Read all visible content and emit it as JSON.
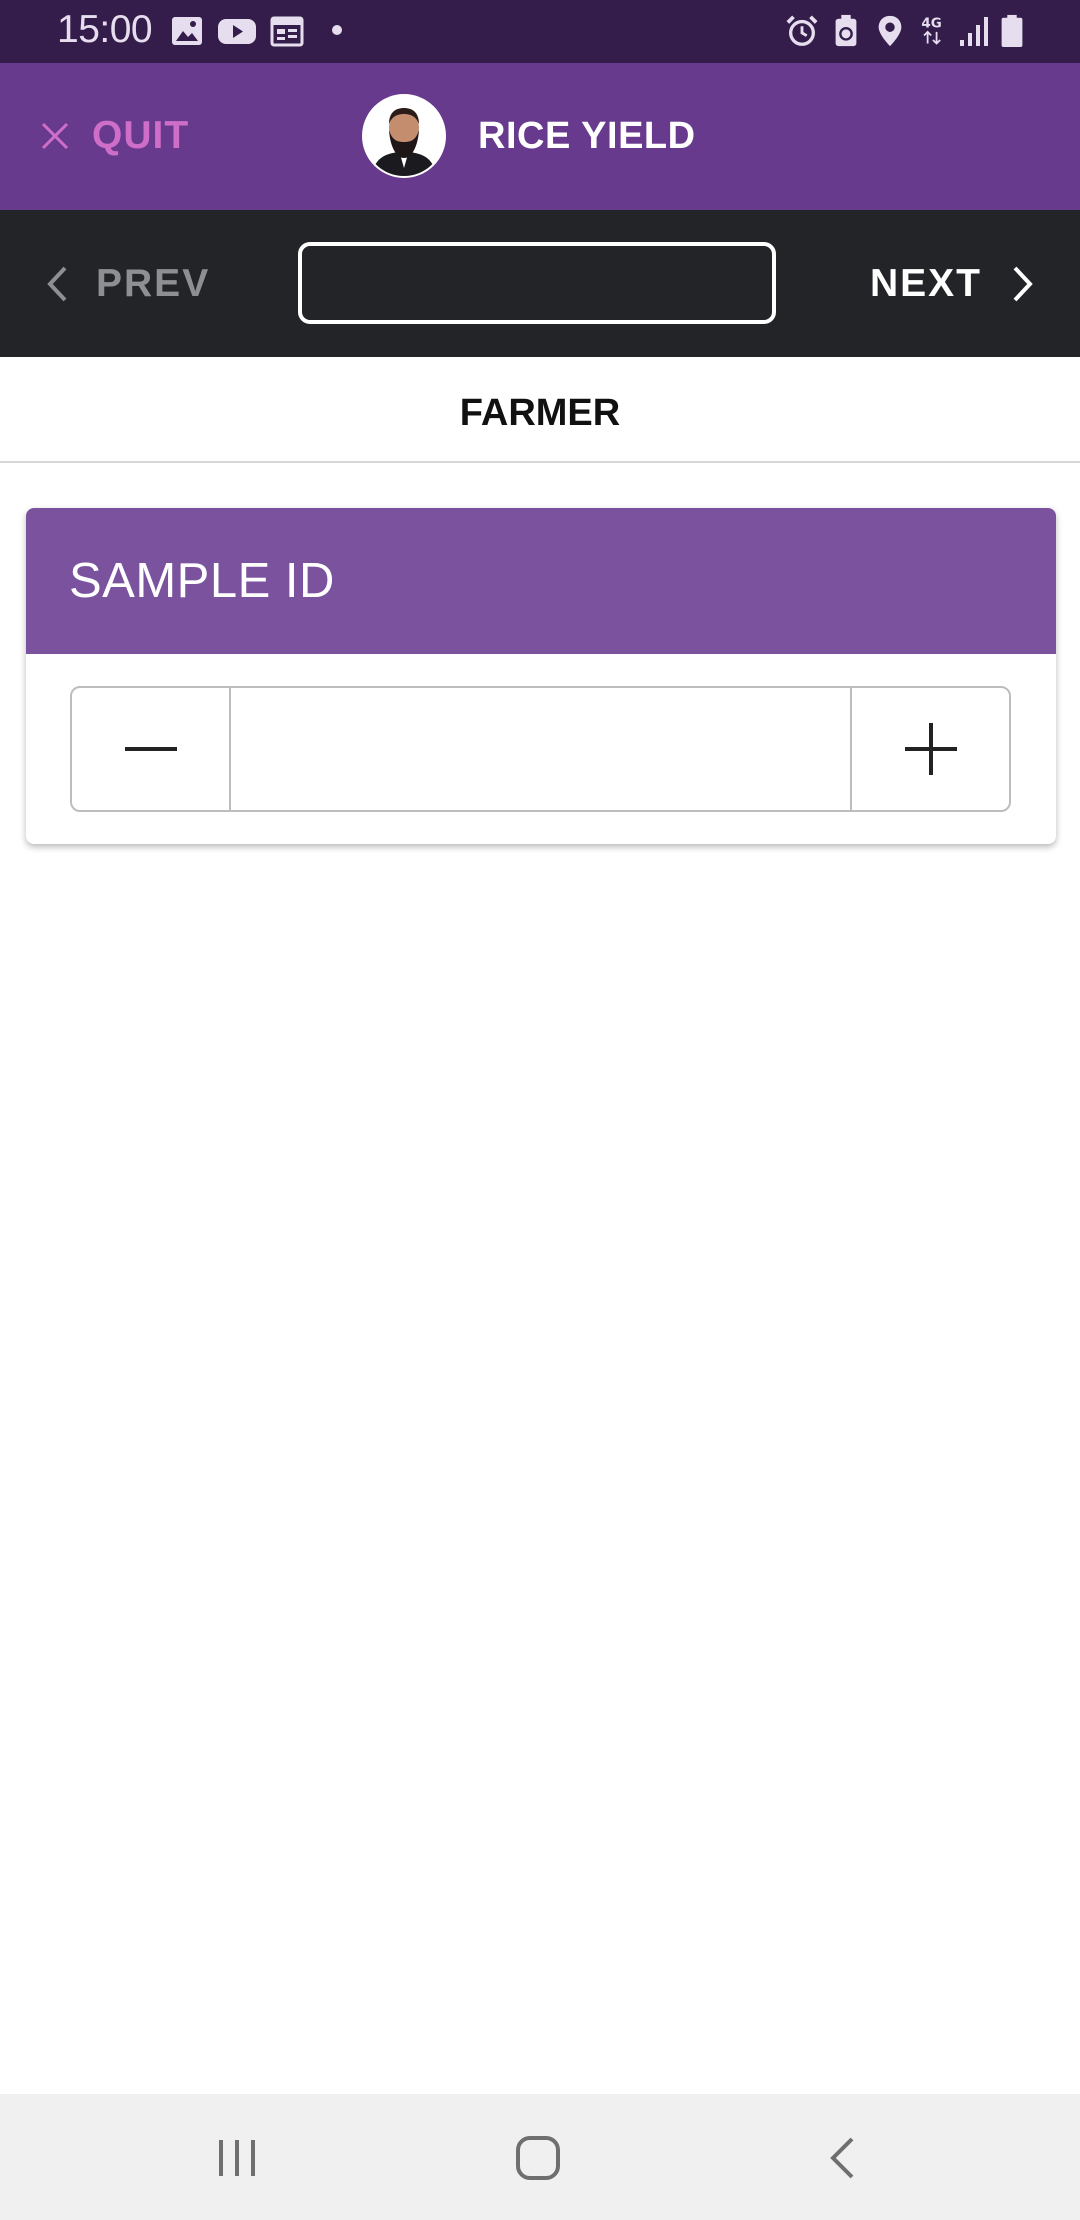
{
  "status_bar": {
    "time": "15:00",
    "left_icons": [
      "image-icon",
      "youtube-icon",
      "calendar-icon",
      "dot-icon"
    ],
    "right_icons": [
      "alarm-icon",
      "battery-saver-icon",
      "location-icon",
      "4g-icon",
      "signal-icon",
      "battery-icon"
    ],
    "network": "4G"
  },
  "header": {
    "quit_label": "QUIT",
    "title": "RICE YIELD",
    "accent": "#673a8d",
    "quit_color": "#cf6ec8"
  },
  "nav": {
    "prev_label": "PREV",
    "next_label": "NEXT",
    "page_value": ""
  },
  "section": {
    "title": "FARMER"
  },
  "card": {
    "header": "SAMPLE ID",
    "header_color": "#7a529d",
    "value": "",
    "decrement_icon": "minus-icon",
    "increment_icon": "plus-icon"
  },
  "system_nav": {
    "icons": [
      "recent-apps-icon",
      "home-icon",
      "back-icon"
    ]
  }
}
